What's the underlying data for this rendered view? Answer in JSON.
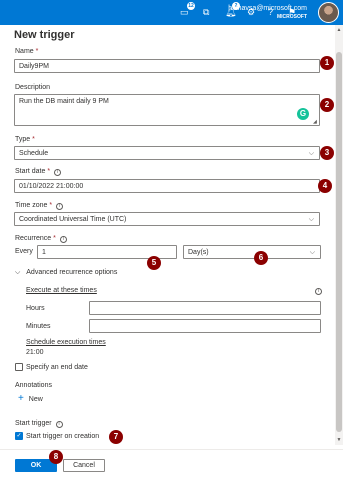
{
  "header": {
    "notification_badge_1": "12",
    "notification_badge_2": "2",
    "user_email": "hibhavsa@microsoft.com",
    "user_tenant": "MICROSOFT"
  },
  "panel": {
    "title": "New trigger"
  },
  "form": {
    "name_label": "Name",
    "name_value": "Daily9PM",
    "description_label": "Description",
    "description_value": "Run the DB maint daily 9 PM",
    "type_label": "Type",
    "type_value": "Schedule",
    "start_date_label": "Start date",
    "start_date_value": "01/10/2022 21:00:00",
    "time_zone_label": "Time zone",
    "time_zone_value": "Coordinated Universal Time (UTC)",
    "recurrence_label": "Recurrence",
    "every_label": "Every",
    "every_value": "1",
    "unit_value": "Day(s)",
    "required_mark": "*",
    "advanced_label": "Advanced recurrence options",
    "execute_label": "Execute at these times",
    "hours_label": "Hours",
    "hours_value": "",
    "minutes_label": "Minutes",
    "minutes_value": "",
    "schedule_label": "Schedule execution times",
    "schedule_value": "21:00",
    "end_date_label": "Specify an end date",
    "annotations_label": "Annotations",
    "new_label": "New",
    "start_trigger_label": "Start trigger",
    "start_on_creation_label": "Start trigger on creation",
    "start_on_creation_checked": true
  },
  "buttons": {
    "ok": "OK",
    "cancel": "Cancel"
  },
  "markers": [
    "1",
    "2",
    "3",
    "4",
    "5",
    "6",
    "7",
    "8"
  ],
  "colors": {
    "accent": "#0078d4",
    "marker": "#8b0000",
    "grammarly": "#15c39a"
  }
}
